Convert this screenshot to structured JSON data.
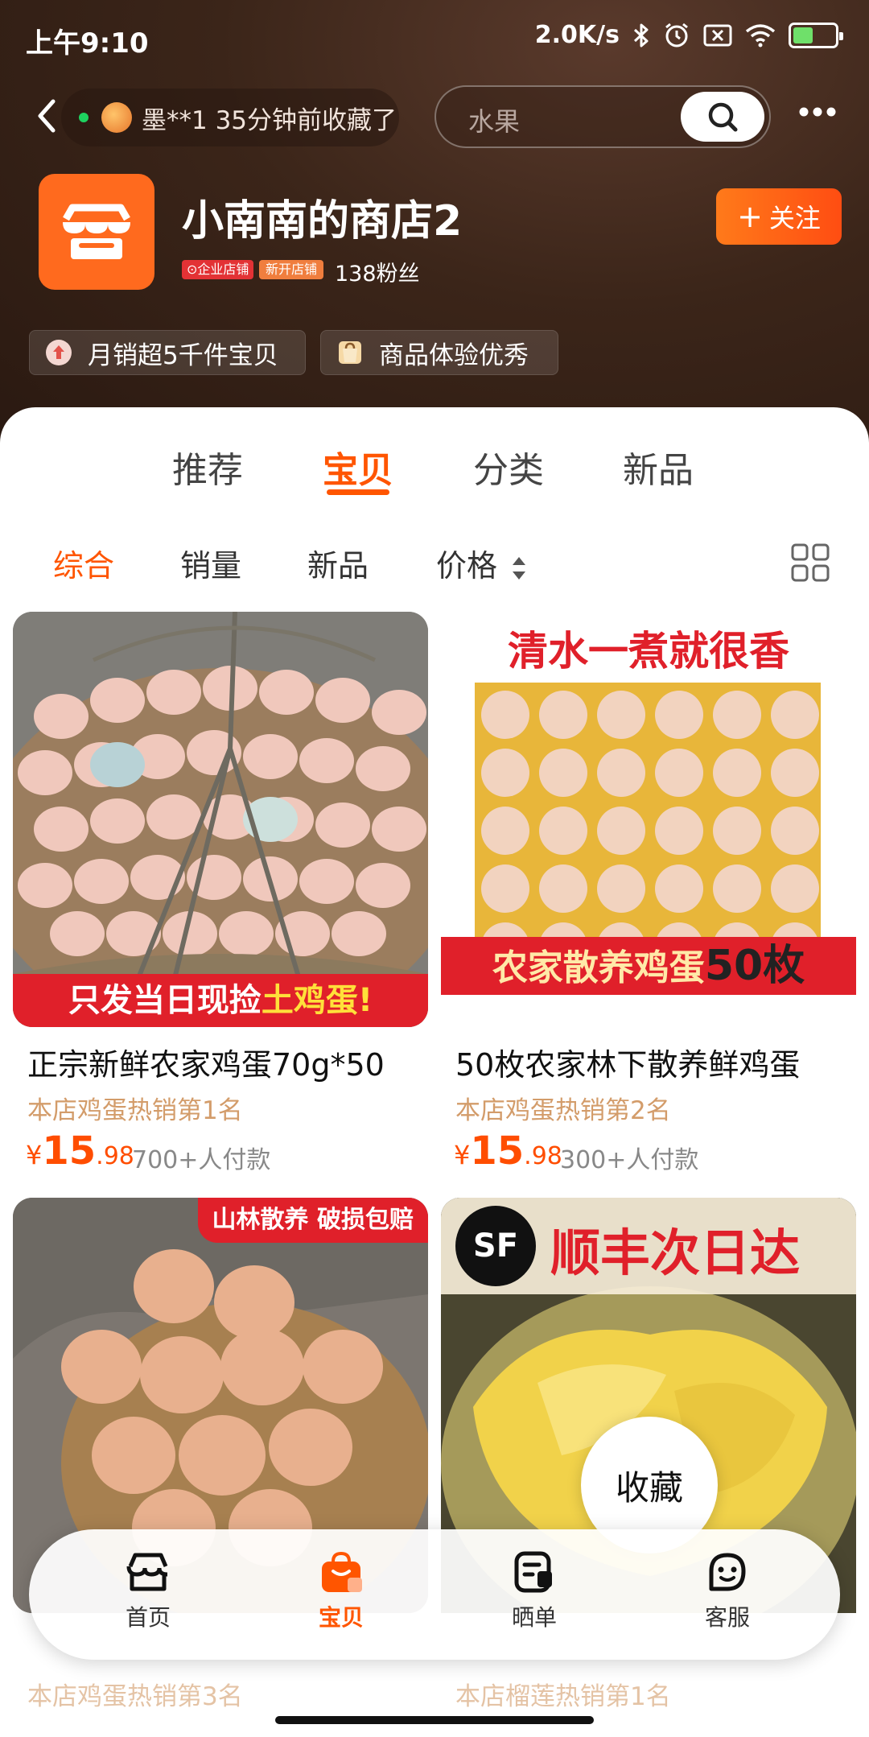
{
  "status_bar": {
    "time": "上午9:10",
    "net_speed": "2.0K/s"
  },
  "header": {
    "visitor_notice": "墨**1 35分钟前收藏了",
    "search_placeholder": "水果",
    "shop_name": "小南南的商店2",
    "badge_enterprise": "企业店铺",
    "badge_new": "新开店铺",
    "fans": "138粉丝",
    "follow_label": "关注",
    "chips": [
      "月销超5千件宝贝",
      "商品体验优秀"
    ]
  },
  "tabs": [
    {
      "label": "推荐",
      "active": false
    },
    {
      "label": "宝贝",
      "active": true
    },
    {
      "label": "分类",
      "active": false
    },
    {
      "label": "新品",
      "active": false
    }
  ],
  "sort_options": [
    {
      "label": "综合",
      "active": true
    },
    {
      "label": "销量",
      "active": false
    },
    {
      "label": "新品",
      "active": false
    },
    {
      "label": "价格",
      "active": false
    }
  ],
  "products": [
    {
      "title": "正宗新鲜农家鸡蛋70g*50",
      "rank": "本店鸡蛋热销第1名",
      "price_int": "15",
      "price_dec": ".98",
      "sold": "700+人付款",
      "banner_a": "只发当日现捡",
      "banner_b": "土鸡蛋!"
    },
    {
      "title": "50枚农家林下散养鲜鸡蛋",
      "rank": "本店鸡蛋热销第2名",
      "price_int": "15",
      "price_dec": ".98",
      "sold": "300+人付款",
      "top_banner": "清水一煮就很香",
      "banner_a": "农家散养鸡蛋",
      "banner_b": "50枚"
    },
    {
      "top_banner": "山林散养 破损包赔",
      "rank": "本店鸡蛋热销第3名"
    },
    {
      "top_banner": "顺丰次日达",
      "sf_logo": "SF",
      "rank": "本店榴莲热销第1名"
    }
  ],
  "currency": "¥",
  "favorite_label": "收藏",
  "tabbar": [
    {
      "label": "首页",
      "icon": "shop-home-icon",
      "active": false
    },
    {
      "label": "宝贝",
      "icon": "bag-icon",
      "active": true
    },
    {
      "label": "晒单",
      "icon": "review-icon",
      "active": false
    },
    {
      "label": "客服",
      "icon": "service-icon",
      "active": false
    }
  ],
  "colors": {
    "accent": "#ff5500",
    "header_bg": "#3b2519",
    "rank_text": "#d39c6a"
  }
}
